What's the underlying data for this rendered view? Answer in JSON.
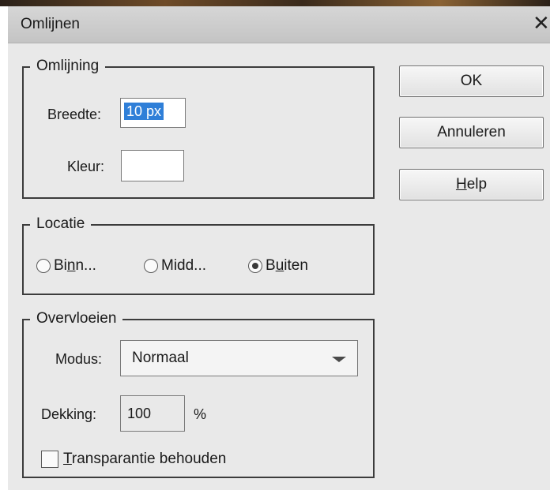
{
  "dialog": {
    "title": "Omlijnen",
    "close_glyph": "✕"
  },
  "stroke_group": {
    "title": "Omlijning",
    "width_label": "Breedte:",
    "width_value": "10 px",
    "color_label": "Kleur:",
    "color_value": "#ffffff"
  },
  "location_group": {
    "title": "Locatie",
    "options": [
      {
        "label_pre": "Bi",
        "label_ul": "n",
        "label_post": "n...",
        "checked": false
      },
      {
        "label_pre": "Midd...",
        "label_ul": "",
        "label_post": "",
        "checked": false
      },
      {
        "label_pre": "B",
        "label_ul": "u",
        "label_post": "iten",
        "checked": true
      }
    ]
  },
  "blend_group": {
    "title": "Overvloeien",
    "mode_label": "Modus:",
    "mode_value": "Normaal",
    "opacity_label": "Dekking:",
    "opacity_value": "100",
    "opacity_unit": "%",
    "preserve_label_ul": "T",
    "preserve_label_rest": "ransparantie behouden",
    "preserve_checked": false
  },
  "buttons": {
    "ok": "OK",
    "cancel": "Annuleren",
    "help_ul": "H",
    "help_rest": "elp"
  },
  "icons": {
    "close": "close-icon",
    "dropdown": "chevron-down-icon"
  }
}
